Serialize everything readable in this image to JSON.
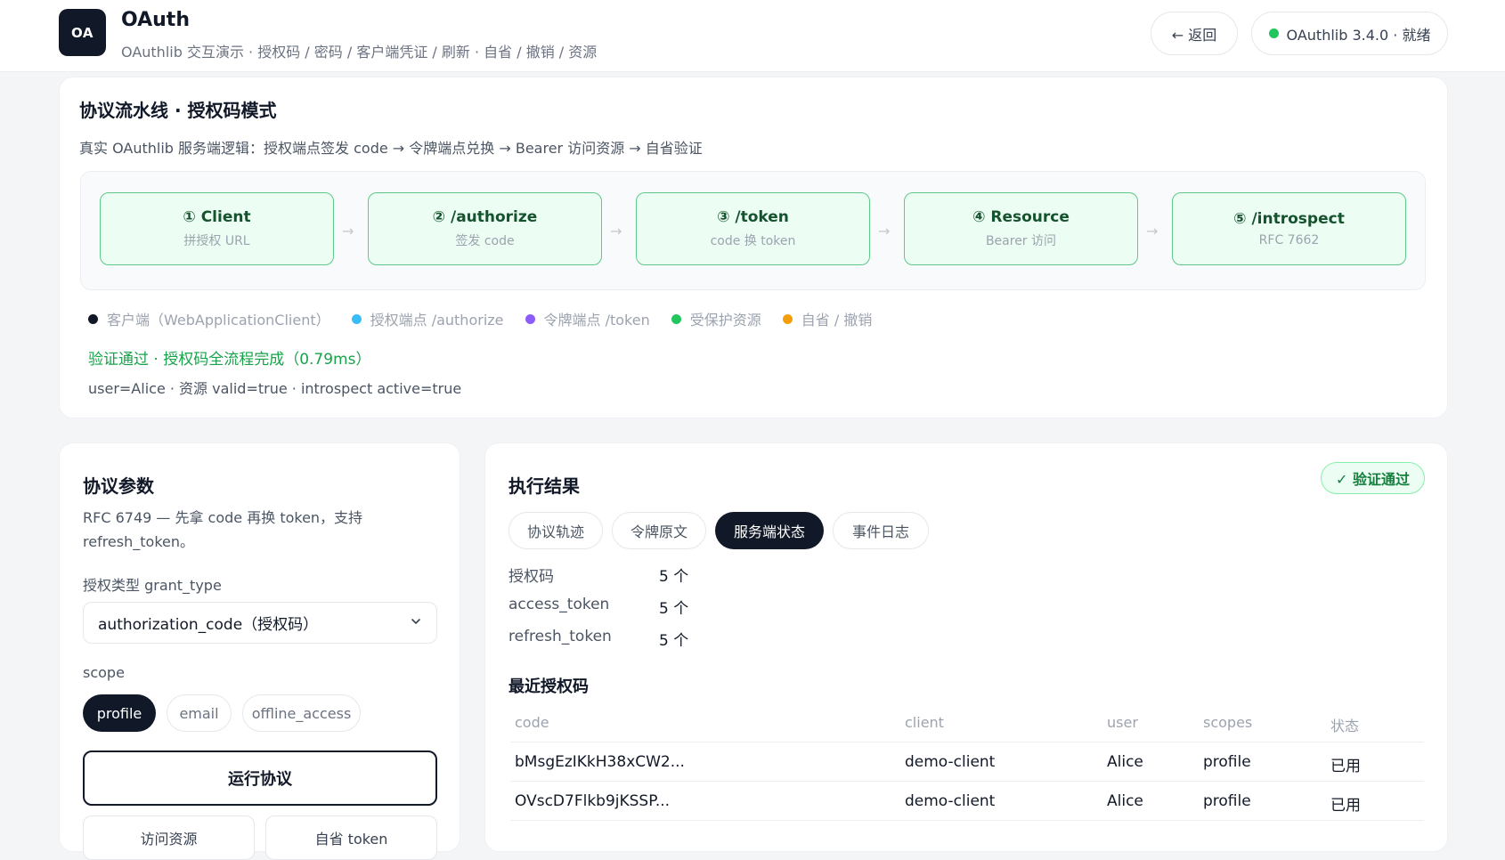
{
  "header": {
    "logo_text": "OA",
    "title": "OAuth",
    "subtitle": "OAuthlib 交互演示 · 授权码 / 密码 / 客户端凭证 / 刷新 · 自省 / 撤销 / 资源",
    "back_label": "← 返回",
    "status_label": "OAuthlib 3.4.0 · 就绪",
    "status_color": "#22c55e"
  },
  "pipeline": {
    "title": "协议流水线 · 授权码模式",
    "description": "真实 OAuthlib 服务端逻辑：授权端点签发 code → 令牌端点兑换 → Bearer 访问资源 → 自省验证",
    "stages": [
      {
        "title": "① Client",
        "sub": "拼授权 URL"
      },
      {
        "title": "② /authorize",
        "sub": "签发 code"
      },
      {
        "title": "③ /token",
        "sub": "code 换 token"
      },
      {
        "title": "④ Resource",
        "sub": "Bearer 访问"
      },
      {
        "title": "⑤ /introspect",
        "sub": "RFC 7662"
      }
    ],
    "arrow": "→",
    "legend": [
      {
        "label": "客户端（WebApplicationClient）",
        "color": "#111827"
      },
      {
        "label": "授权端点 /authorize",
        "color": "#38bdf8"
      },
      {
        "label": "令牌端点 /token",
        "color": "#8b5cf6"
      },
      {
        "label": "受保护资源",
        "color": "#22c55e"
      },
      {
        "label": "自省 / 撤销",
        "color": "#f59e0b"
      }
    ],
    "verify_result": "验证通过 · 授权码全流程完成（0.79ms）",
    "verify_detail": "user=Alice · 资源 valid=true · introspect active=true"
  },
  "params": {
    "title": "协议参数",
    "description": "RFC 6749 — 先拿 code 再换 token，支持 refresh_token。",
    "grant_label": "授权类型 grant_type",
    "grant_value": "authorization_code（授权码）",
    "scope_label": "scope",
    "scopes": [
      {
        "label": "profile",
        "selected": true
      },
      {
        "label": "email",
        "selected": false
      },
      {
        "label": "offline_access",
        "selected": false
      }
    ],
    "run_label": "运行协议",
    "access_label": "访问资源",
    "introspect_label": "自省 token"
  },
  "results": {
    "title": "执行结果",
    "badge": "✓ 验证通过",
    "tabs": [
      {
        "label": "协议轨迹",
        "active": false
      },
      {
        "label": "令牌原文",
        "active": false
      },
      {
        "label": "服务端状态",
        "active": true
      },
      {
        "label": "事件日志",
        "active": false
      }
    ],
    "stats": [
      {
        "label": "授权码",
        "value": "5 个"
      },
      {
        "label": "access_token",
        "value": "5 个"
      },
      {
        "label": "refresh_token",
        "value": "5 个"
      }
    ],
    "recent_title": "最近授权码",
    "table_headers": [
      "code",
      "client",
      "user",
      "scopes",
      "状态"
    ],
    "rows": [
      [
        "bMsgEzIKkH38xCW2...",
        "demo-client",
        "Alice",
        "profile",
        "已用"
      ],
      [
        "OVscD7Flkb9jKSSP...",
        "demo-client",
        "Alice",
        "profile",
        "已用"
      ]
    ]
  }
}
